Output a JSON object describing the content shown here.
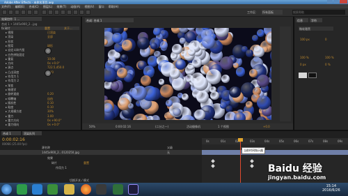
{
  "window": {
    "title": "Adobe After Effects - 未命名项目.aep"
  },
  "menu": [
    "文件(F)",
    "编辑(E)",
    "合成(C)",
    "图层(L)",
    "效果(T)",
    "动画(A)",
    "视图(V)",
    "窗口",
    "帮助(H)"
  ],
  "toolbar": {
    "workspace_label": "工作区:",
    "workspace_value": "所有面板",
    "search_placeholder": "搜索帮助"
  },
  "left_panel": {
    "tab": "效果控件: 1 ...",
    "header": "合成 1 • 1445x900_2...jpg",
    "effect_name": "fx 碎片",
    "reset_label": "重置",
    "about_label": "关于...",
    "rows": [
      {
        "label": "视图",
        "value": "已渲染"
      },
      {
        "label": "渲染",
        "value": "全部"
      },
      {
        "label": "形状",
        "value": ""
      },
      {
        "label": "图案",
        "value": "球形"
      },
      {
        "label": "自定义碎片图",
        "value": "无"
      },
      {
        "label": "白色拼贴固定",
        "value": ""
      },
      {
        "label": "重复",
        "value": "10.00"
      },
      {
        "label": "方向",
        "value": "0x +0.0°"
      },
      {
        "label": "源点",
        "value": "722.5,450.0"
      },
      {
        "label": "凸出深度",
        "value": "0.20"
      },
      {
        "label": "作用力 1",
        "value": ""
      },
      {
        "label": "作用力 2",
        "value": ""
      },
      {
        "label": "渐变",
        "value": ""
      },
      {
        "label": "物理学",
        "value": ""
      },
      {
        "label": "旋转速度",
        "value": "0.20"
      },
      {
        "label": "倾覆轴",
        "value": "自由"
      },
      {
        "label": "随机性",
        "value": "0.10"
      },
      {
        "label": "粘度",
        "value": "0.10"
      },
      {
        "label": "大规模方差",
        "value": "30%"
      },
      {
        "label": "重力",
        "value": "3.00"
      },
      {
        "label": "重力方向",
        "value": "0x +90.0°"
      },
      {
        "label": "重力倾向",
        "value": "0x +0.0°"
      }
    ]
  },
  "viewer": {
    "tab": "合成: 合成 1",
    "zoom": "50%",
    "timecode": "0:00:02:16",
    "quality": "(二分之一)",
    "camera": "活动摄像机",
    "views": "1 个视图",
    "exposure": "+0.0"
  },
  "right_panel": {
    "tab1": "信息",
    "tab2": "字符",
    "font": "微软雅黑",
    "size": "100 px",
    "tracking": "0",
    "scale_v": "100 %",
    "scale_h": "100 %",
    "baseline": "0 px",
    "tsume": "0 %"
  },
  "timeline": {
    "tab": "合成 1",
    "tab2": "渲染队列",
    "timecode": "0:00:02:16",
    "fps": "00066 (25.00 fps)",
    "col_source": "源名称",
    "col_parent": "父级",
    "layer_name": "1445x900_2...0120250.jpg",
    "parent_value": "无",
    "sub_rows": [
      "效果",
      "碎片"
    ],
    "sub_values": [
      "",
      "重置"
    ],
    "property": "作用力 1",
    "ruler": [
      "0s",
      "01s",
      "02s",
      "03s",
      "04s",
      "05s",
      "06s",
      "07s",
      "08s",
      "09s"
    ],
    "tooltip": "当前时间指示器",
    "toggle": "切换开关 / 模式"
  },
  "taskbar": {
    "time": "15:14",
    "date": "2016/6/26"
  },
  "watermark": {
    "brand": "Baidu 经验",
    "url": "jingyan.baidu.com"
  },
  "colors": {
    "accent": "#c08a2d",
    "titlebar": "#4f86c0",
    "playhead": "#e04a2e"
  }
}
